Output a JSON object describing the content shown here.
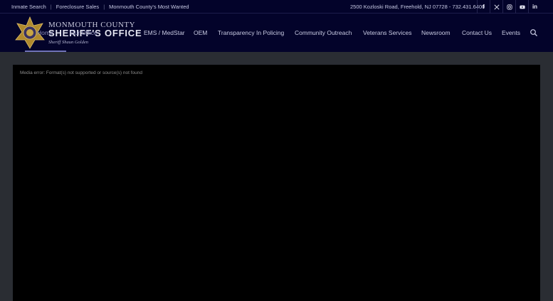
{
  "topbar": {
    "links": [
      {
        "label": "Inmate Search"
      },
      {
        "label": "Foreclosure Sales"
      },
      {
        "label": "Monmouth County's Most Wanted"
      }
    ],
    "address": "2500 Kozloski Road, Freehold, NJ 07728 - 732.431.6400",
    "social": [
      "facebook-icon",
      "x-icon",
      "instagram-icon",
      "youtube-icon",
      "linkedin-icon"
    ]
  },
  "logo": {
    "line1": "MONMOUTH COUNTY",
    "line2": "SHERIFF'S OFFICE",
    "line3": "Sheriff Shaun Golden"
  },
  "nav": {
    "items": [
      {
        "label": "Home"
      },
      {
        "label": "Our Office"
      },
      {
        "label": "EMS / MedStar"
      },
      {
        "label": "OEM"
      },
      {
        "label": "Transparency In Policing"
      },
      {
        "label": "Community Outreach"
      },
      {
        "label": "Veterans Services"
      },
      {
        "label": "Newsroom"
      },
      {
        "label": "Contact Us"
      },
      {
        "label": "Events"
      }
    ]
  },
  "media": {
    "error": "Media error: Format(s) not supported or source(s) not found"
  },
  "colors": {
    "header_bg": "#03032a",
    "page_bg": "#2a2d33",
    "player_bg": "#000000",
    "active_underline": "#6f72b8"
  }
}
